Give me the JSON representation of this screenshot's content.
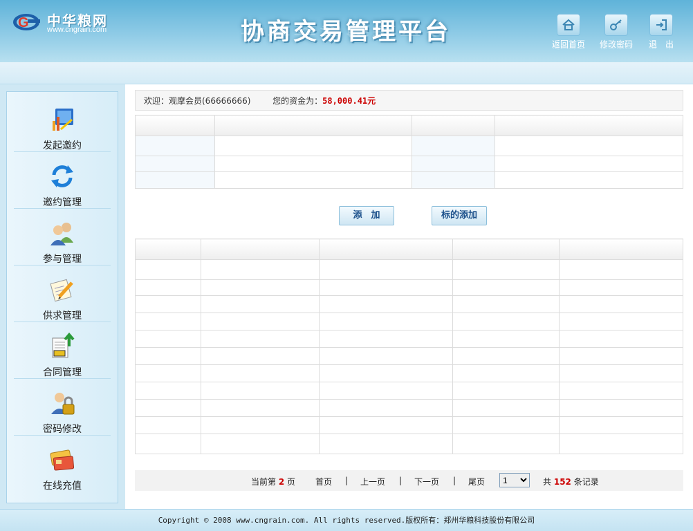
{
  "header": {
    "logo_name": "中华粮网",
    "logo_url": "www.cngrain.com",
    "title": "协商交易管理平台",
    "buttons": [
      {
        "label": "返回首页",
        "icon": "home-icon"
      },
      {
        "label": "修改密码",
        "icon": "key-icon"
      },
      {
        "label": "退　出",
        "icon": "exit-icon"
      }
    ]
  },
  "sidebar": {
    "items": [
      {
        "label": "发起邀约",
        "icon": "chart-launch-icon"
      },
      {
        "label": "邀约管理",
        "icon": "refresh-arrows-icon"
      },
      {
        "label": "参与管理",
        "icon": "users-icon"
      },
      {
        "label": "供求管理",
        "icon": "notepad-pencil-icon"
      },
      {
        "label": "合同管理",
        "icon": "contract-upload-icon"
      },
      {
        "label": "密码修改",
        "icon": "user-lock-icon"
      },
      {
        "label": "在线充值",
        "icon": "credit-card-icon"
      }
    ]
  },
  "welcome": {
    "prefix": "欢迎：观摩会员(66666666)",
    "funds_label": "您的资金为：",
    "funds_value": "58,000.41元"
  },
  "actions": {
    "add_label": "添　加",
    "bid_add_label": "标的添加"
  },
  "pager": {
    "current_prefix": "当前第",
    "current_page": "2",
    "current_suffix": "页",
    "first": "首页",
    "prev": "上一页",
    "next": "下一页",
    "last": "尾页",
    "sep": "|",
    "page_select_value": "1",
    "total_prefix": "共",
    "total": "152",
    "total_suffix": "条记录"
  },
  "footer": {
    "text": "Copyright © 2008 www.cngrain.com. All rights reserved.版权所有：郑州华粮科技股份有限公司"
  },
  "colors": {
    "header_blue": "#5fb3d9",
    "accent_red": "#cc0000",
    "button_text": "#1a4f8a"
  }
}
